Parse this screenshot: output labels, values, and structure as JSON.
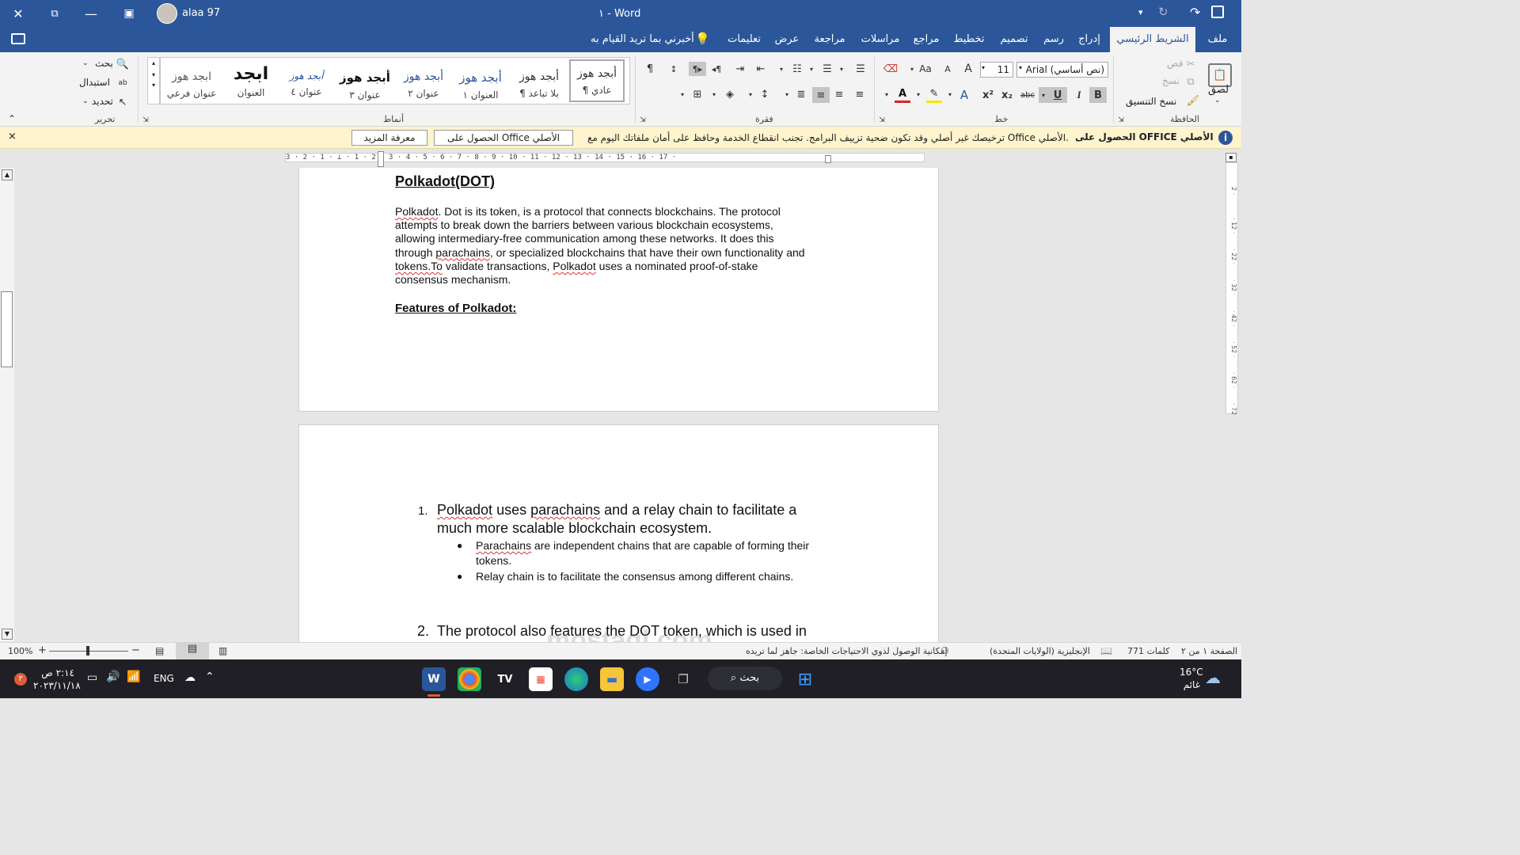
{
  "titlebar": {
    "doc_name": "١",
    "separator": "-",
    "app_name": "Word",
    "user_name": "alaa 97",
    "quick_access": {
      "save": "Save",
      "redo": "Redo",
      "undo": "Undo",
      "customize": "▾"
    }
  },
  "tabs": {
    "file": "ملف",
    "home": "الشريط الرئيسي",
    "insert": "إدراج",
    "draw": "رسم",
    "design": "تصميم",
    "layout": "تخطيط",
    "references": "مراجع",
    "mailings": "مراسلات",
    "review": "مراجعة",
    "view": "عرض",
    "help": "تعليمات",
    "tell_me": "أخبرني بما تريد القيام به"
  },
  "ribbon": {
    "clipboard": {
      "label": "الحافظة",
      "paste": "لصق",
      "cut": "قص",
      "copy": "نسخ",
      "format_painter": "نسخ التنسيق"
    },
    "font": {
      "label": "خط",
      "font_name": "Arial (نص أساسي)",
      "font_size": "11",
      "bold": "B",
      "italic": "I",
      "underline": "U",
      "strike": "abc",
      "subscript": "x₂",
      "superscript": "x²",
      "grow": "A",
      "shrink": "A",
      "case": "Aa"
    },
    "paragraph": {
      "label": "فقرة"
    },
    "styles": {
      "label": "أنماط",
      "items": [
        {
          "preview": "أبجد هوز",
          "name": "¶ عادي"
        },
        {
          "preview": "أبجد هوز",
          "name": "¶ بلا تباعد"
        },
        {
          "preview": "أبجد هوز",
          "name": "العنوان ١"
        },
        {
          "preview": "أبجد هوز",
          "name": "عنوان ٢"
        },
        {
          "preview": "أبجد هوز",
          "name": "عنوان ٣"
        },
        {
          "preview": "أبجد هوز",
          "name": "عنوان ٤"
        },
        {
          "preview": "ابجد",
          "name": "العنوان"
        },
        {
          "preview": "ابجد هوز",
          "name": "عنوان فرعي"
        }
      ]
    },
    "editing": {
      "label": "تحرير",
      "find": "بحث",
      "replace": "استبدال",
      "select": "تحديد"
    }
  },
  "notice": {
    "title": "الحصول على OFFICE الأصلي",
    "message": "ترخيصك غير أصلي وقد تكون ضحية تزييف البرامج. تجنب انقطاع الخدمة وحافظ على أمان ملفاتك اليوم مع Office الأصلي.",
    "get_genuine_button": "الحصول على Office الأصلي",
    "learn_more_button": "معرفة المزيد",
    "close": "×"
  },
  "ruler": "3 · 2 · 1 · ⊥ · 1 · 2 · 3 · 4 · 5 · 6 · 7 · 8 · 9 · 10 · 11 · 12 · 13 · 14 · 15 · 16 · 17 ·",
  "vruler": [
    "2 ·",
    "· 12 ·",
    "· 22 ·",
    "· 32 ·",
    "· 42 ·",
    "· 52 ·",
    "· 62 ·",
    "· 72"
  ],
  "document": {
    "page1": {
      "heading": "Polkadot(DOT)",
      "para_lines": [
        [
          "Polkadot",
          ". Dot is its token, is a protocol that connects blockchains. The protocol"
        ],
        [
          "",
          "attempts to break down the barriers between various blockchain ecosystems,"
        ],
        [
          "",
          "allowing intermediary-free communication among these networks. It does this"
        ],
        [
          "through ",
          "parachains",
          ", or specialized blockchains that have their own functionality and"
        ],
        [
          "tokens.To",
          " validate transactions, ",
          "Polkadot",
          " uses a nominated proof-of-stake"
        ],
        [
          "",
          "consensus mechanism."
        ]
      ],
      "features_heading": "Features of Polkadot:"
    },
    "page2": {
      "item1_number": "1.",
      "item1_word1": "Polkadot",
      "item1_mid1": " uses ",
      "item1_word2": "parachains",
      "item1_rest1": " and a relay chain to facilitate a",
      "item1_line2": "much more scalable blockchain ecosystem.",
      "bullet1_word": "Parachains",
      "bullet1_rest": " are independent chains that are capable of forming their",
      "bullet1_line2": "tokens.",
      "bullet2": "Relay chain is to facilitate the consensus among different chains.",
      "item2_number": "2.",
      "item2_text": "The protocol also features the DOT token, which is used in"
    }
  },
  "status": {
    "page": "الصفحة ١ من ٢",
    "words": "771 كلمات",
    "language": "الإنجليزية (الولايات المتحدة)",
    "accessibility": "إمكانية الوصول لذوي الاحتياجات الخاصة: جاهز لما تريده",
    "zoom": "100%"
  },
  "taskbar": {
    "weather_temp": "16°C",
    "weather_desc": "غائم",
    "search": "بحث",
    "lang": "ENG",
    "time": "٢:١٤ ص",
    "date": "٢٠٢٣/١١/١٨",
    "notifications": "٣"
  },
  "watermark": "mostaql.com",
  "colors": {
    "accent": "#2b579a",
    "notice_bg": "#fff4ce",
    "taskbar": "#1f1f25"
  }
}
